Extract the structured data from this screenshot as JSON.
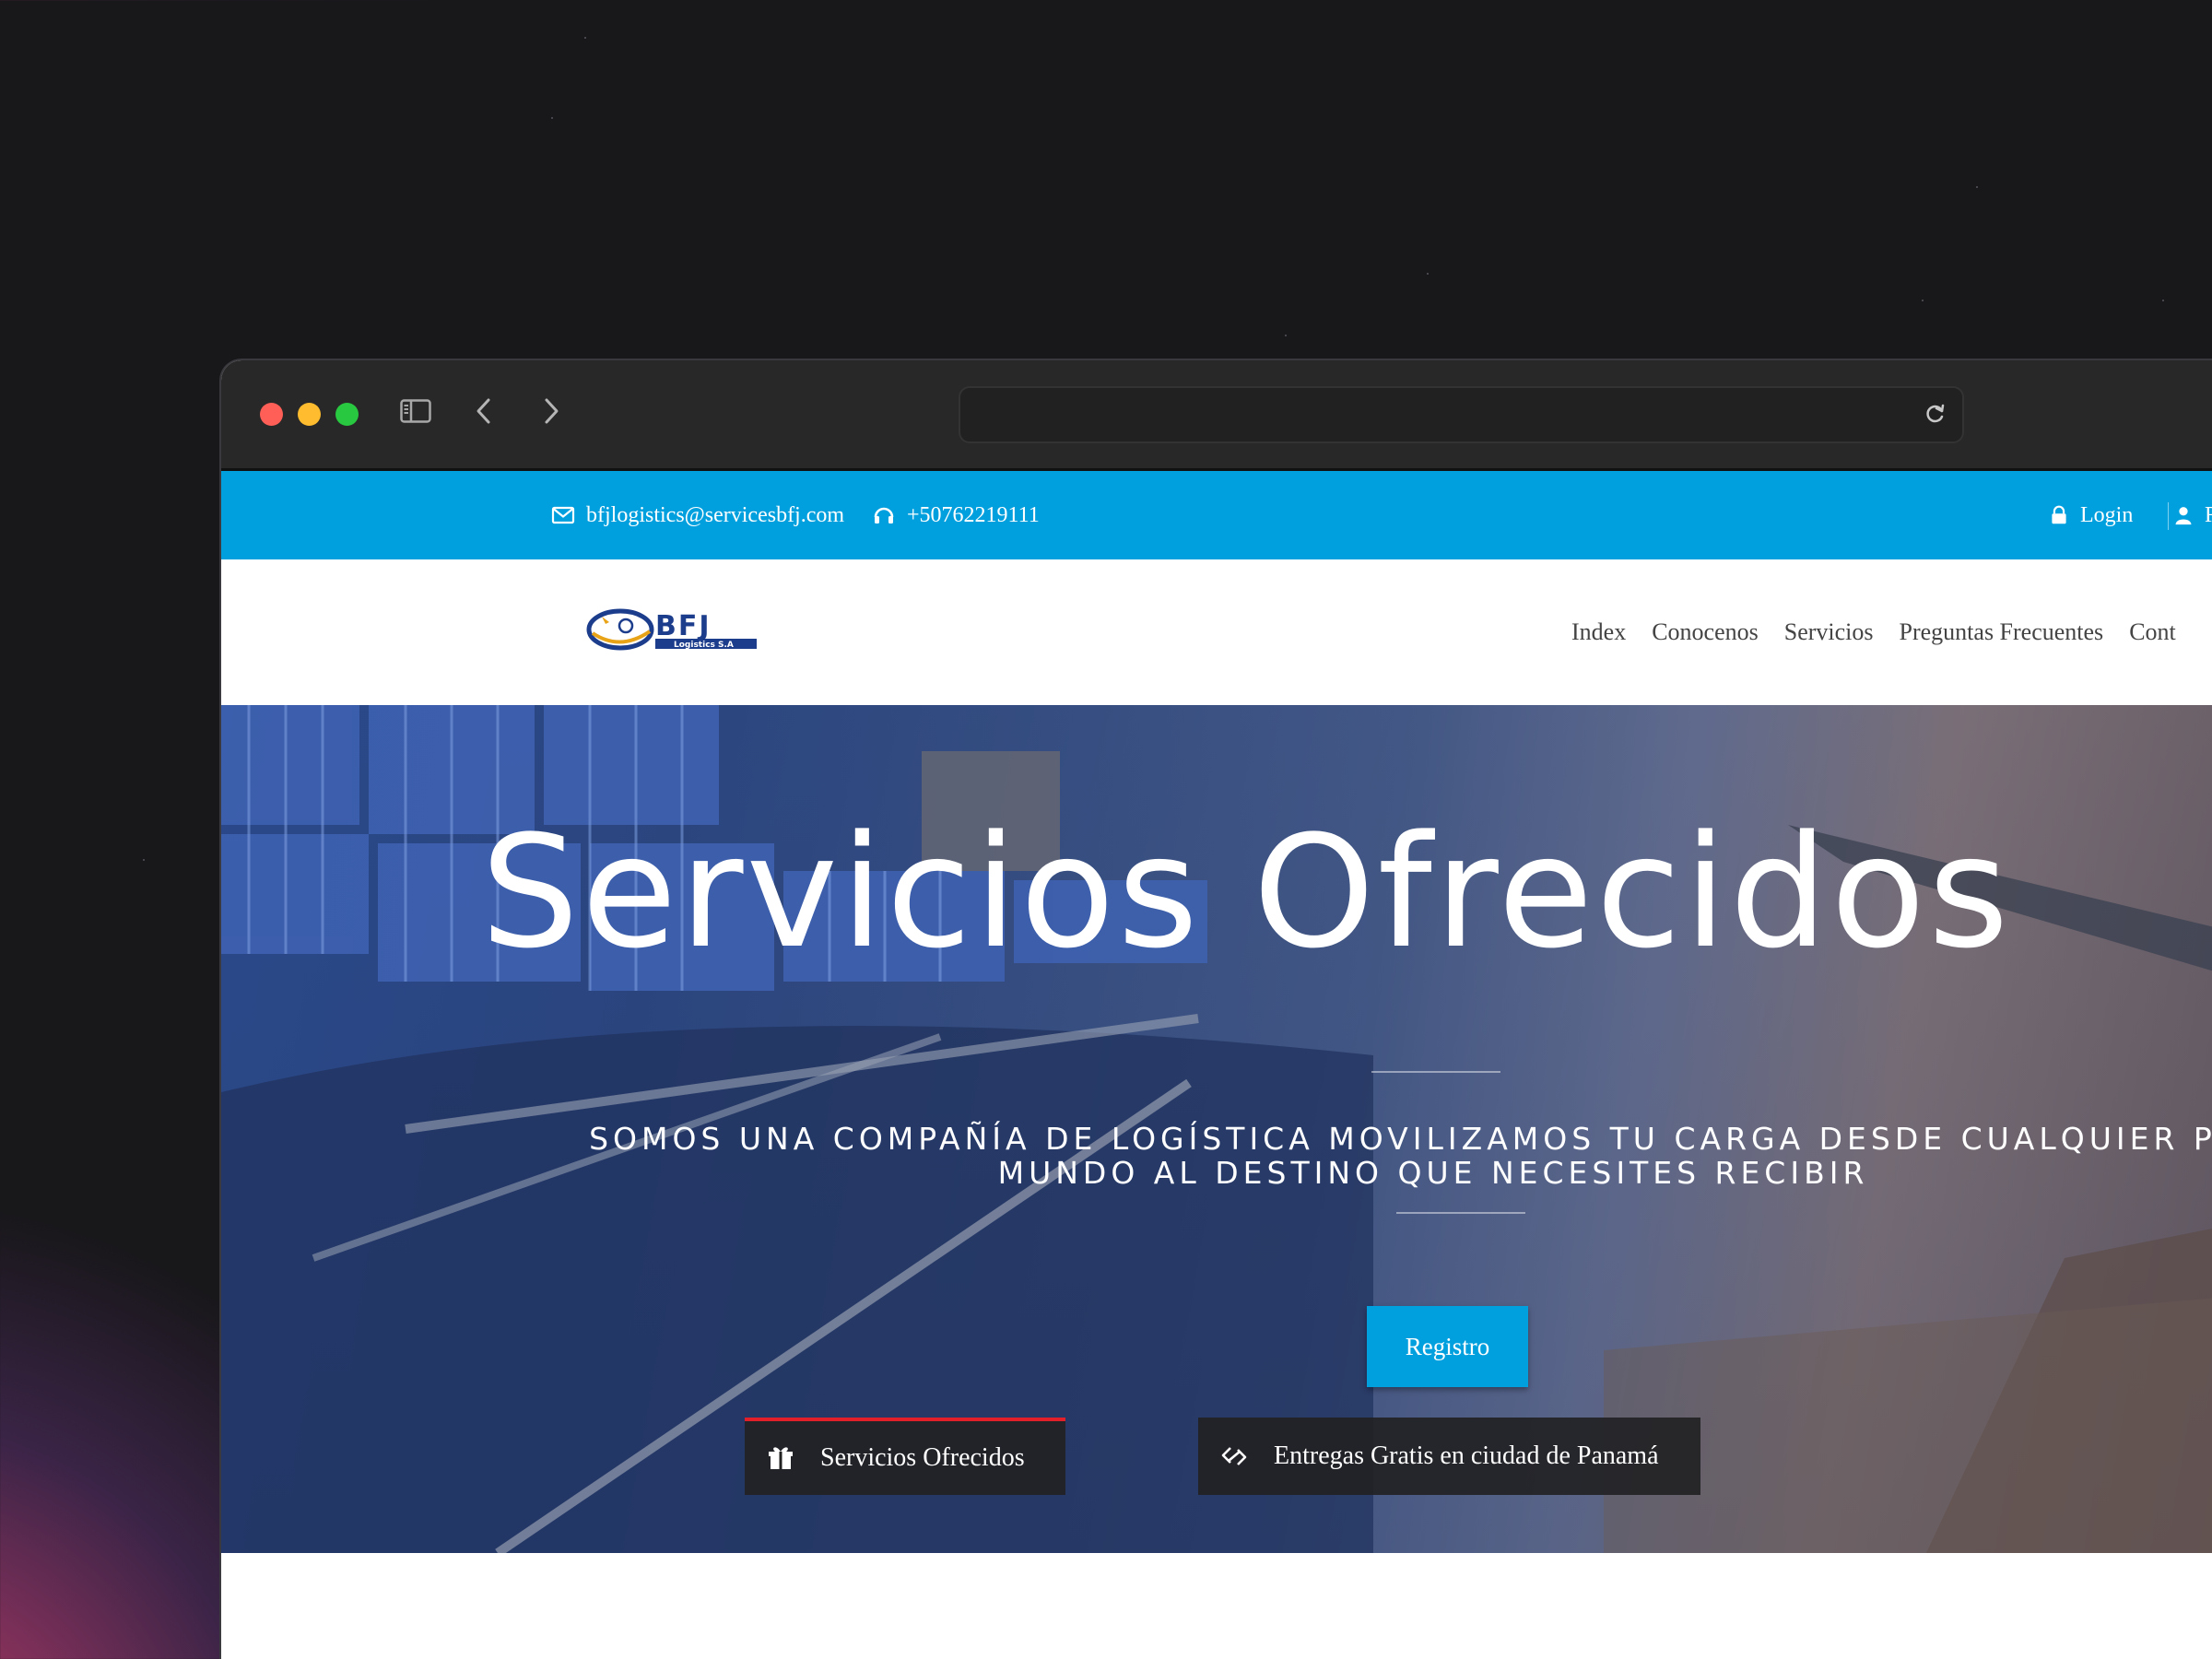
{
  "topbar": {
    "email": "bfjlogistics@servicesbfj.com",
    "phone": "+50762219111",
    "login": "Login",
    "register_partial": "R"
  },
  "nav": {
    "items": [
      "Index",
      "Conocenos",
      "Servicios",
      "Preguntas Frecuentes",
      "Cont"
    ]
  },
  "hero": {
    "title": "Servicios Ofrecidos",
    "subtitle_line1": "SOMOS UNA COMPAÑÍA DE LOGÍSTICA MOVILIZAMOS TU CARGA DESDE CUALQUIER PART",
    "subtitle_line2": "MUNDO AL DESTINO QUE NECESITES RECIBIR",
    "cta": "Registro"
  },
  "features": {
    "item1": "Servicios Ofrecidos",
    "item2": "Entregas Gratis en ciudad de Panamá"
  },
  "colors": {
    "topbar": "#00a0df",
    "cta": "#00a0df",
    "feature_accent": "#e3202a"
  }
}
